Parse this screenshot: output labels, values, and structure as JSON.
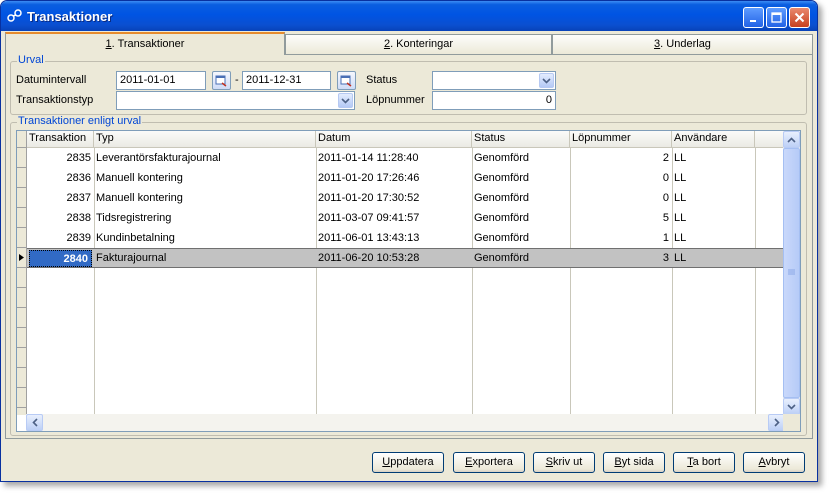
{
  "window": {
    "title": "Transaktioner"
  },
  "tabs": [
    {
      "key": "1",
      "rest": ". Transaktioner"
    },
    {
      "key": "2",
      "rest": ". Konteringar"
    },
    {
      "key": "3",
      "rest": ". Underlag"
    }
  ],
  "urval": {
    "title": "Urval",
    "datumintervall_label": "Datumintervall",
    "date_from": "2011-01-01",
    "date_sep": "-",
    "date_to": "2011-12-31",
    "status_label": "Status",
    "status_value": "",
    "transaktionstyp_label": "Transaktionstyp",
    "transaktionstyp_value": "",
    "lopnummer_label": "Löpnummer",
    "lopnummer_value": "0"
  },
  "grid": {
    "title": "Transaktioner enligt urval",
    "columns": [
      "Transaktion",
      "Typ",
      "Datum",
      "Status",
      "Löpnummer",
      "Användare"
    ],
    "rows": [
      {
        "transaktion": "2835",
        "typ": "Leverantörsfakturajournal",
        "datum": "2011-01-14 11:28:40",
        "status": "Genomförd",
        "lopnummer": "2",
        "anvandare": "LL"
      },
      {
        "transaktion": "2836",
        "typ": "Manuell kontering",
        "datum": "2011-01-20 17:26:46",
        "status": "Genomförd",
        "lopnummer": "0",
        "anvandare": "LL"
      },
      {
        "transaktion": "2837",
        "typ": "Manuell kontering",
        "datum": "2011-01-20 17:30:52",
        "status": "Genomförd",
        "lopnummer": "0",
        "anvandare": "LL"
      },
      {
        "transaktion": "2838",
        "typ": "Tidsregistrering",
        "datum": "2011-03-07 09:41:57",
        "status": "Genomförd",
        "lopnummer": "5",
        "anvandare": "LL"
      },
      {
        "transaktion": "2839",
        "typ": "Kundinbetalning",
        "datum": "2011-06-01 13:43:13",
        "status": "Genomförd",
        "lopnummer": "1",
        "anvandare": "LL"
      },
      {
        "transaktion": "2840",
        "typ": "Fakturajournal",
        "datum": "2011-06-20 10:53:28",
        "status": "Genomförd",
        "lopnummer": "3",
        "anvandare": "LL"
      }
    ],
    "selected_row": 5
  },
  "buttons": [
    {
      "key": "U",
      "rest": "ppdatera"
    },
    {
      "key": "E",
      "rest": "xportera"
    },
    {
      "key": "S",
      "rest": "kriv ut"
    },
    {
      "key": "B",
      "rest": "yt sida"
    },
    {
      "key": "T",
      "rest": "a bort"
    },
    {
      "key": "A",
      "rest": "vbryt"
    }
  ],
  "colors": {
    "title_bar": "#0054e3",
    "accent_text": "#0046d5",
    "selection": "#316ac5",
    "row_selected": "#c2c2c2"
  }
}
